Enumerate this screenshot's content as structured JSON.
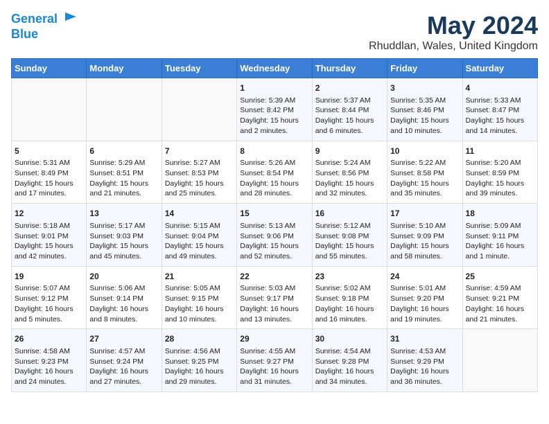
{
  "header": {
    "logo_line1": "General",
    "logo_line2": "Blue",
    "title": "May 2024",
    "subtitle": "Rhuddlan, Wales, United Kingdom"
  },
  "days_of_week": [
    "Sunday",
    "Monday",
    "Tuesday",
    "Wednesday",
    "Thursday",
    "Friday",
    "Saturday"
  ],
  "weeks": [
    [
      {
        "day": "",
        "empty": true
      },
      {
        "day": "",
        "empty": true
      },
      {
        "day": "",
        "empty": true
      },
      {
        "day": "1",
        "sunrise": "5:39 AM",
        "sunset": "8:42 PM",
        "daylight": "15 hours and 2 minutes."
      },
      {
        "day": "2",
        "sunrise": "5:37 AM",
        "sunset": "8:44 PM",
        "daylight": "15 hours and 6 minutes."
      },
      {
        "day": "3",
        "sunrise": "5:35 AM",
        "sunset": "8:46 PM",
        "daylight": "15 hours and 10 minutes."
      },
      {
        "day": "4",
        "sunrise": "5:33 AM",
        "sunset": "8:47 PM",
        "daylight": "15 hours and 14 minutes."
      }
    ],
    [
      {
        "day": "5",
        "sunrise": "5:31 AM",
        "sunset": "8:49 PM",
        "daylight": "15 hours and 17 minutes."
      },
      {
        "day": "6",
        "sunrise": "5:29 AM",
        "sunset": "8:51 PM",
        "daylight": "15 hours and 21 minutes."
      },
      {
        "day": "7",
        "sunrise": "5:27 AM",
        "sunset": "8:53 PM",
        "daylight": "15 hours and 25 minutes."
      },
      {
        "day": "8",
        "sunrise": "5:26 AM",
        "sunset": "8:54 PM",
        "daylight": "15 hours and 28 minutes."
      },
      {
        "day": "9",
        "sunrise": "5:24 AM",
        "sunset": "8:56 PM",
        "daylight": "15 hours and 32 minutes."
      },
      {
        "day": "10",
        "sunrise": "5:22 AM",
        "sunset": "8:58 PM",
        "daylight": "15 hours and 35 minutes."
      },
      {
        "day": "11",
        "sunrise": "5:20 AM",
        "sunset": "8:59 PM",
        "daylight": "15 hours and 39 minutes."
      }
    ],
    [
      {
        "day": "12",
        "sunrise": "5:18 AM",
        "sunset": "9:01 PM",
        "daylight": "15 hours and 42 minutes."
      },
      {
        "day": "13",
        "sunrise": "5:17 AM",
        "sunset": "9:03 PM",
        "daylight": "15 hours and 45 minutes."
      },
      {
        "day": "14",
        "sunrise": "5:15 AM",
        "sunset": "9:04 PM",
        "daylight": "15 hours and 49 minutes."
      },
      {
        "day": "15",
        "sunrise": "5:13 AM",
        "sunset": "9:06 PM",
        "daylight": "15 hours and 52 minutes."
      },
      {
        "day": "16",
        "sunrise": "5:12 AM",
        "sunset": "9:08 PM",
        "daylight": "15 hours and 55 minutes."
      },
      {
        "day": "17",
        "sunrise": "5:10 AM",
        "sunset": "9:09 PM",
        "daylight": "15 hours and 58 minutes."
      },
      {
        "day": "18",
        "sunrise": "5:09 AM",
        "sunset": "9:11 PM",
        "daylight": "16 hours and 1 minute."
      }
    ],
    [
      {
        "day": "19",
        "sunrise": "5:07 AM",
        "sunset": "9:12 PM",
        "daylight": "16 hours and 5 minutes."
      },
      {
        "day": "20",
        "sunrise": "5:06 AM",
        "sunset": "9:14 PM",
        "daylight": "16 hours and 8 minutes."
      },
      {
        "day": "21",
        "sunrise": "5:05 AM",
        "sunset": "9:15 PM",
        "daylight": "16 hours and 10 minutes."
      },
      {
        "day": "22",
        "sunrise": "5:03 AM",
        "sunset": "9:17 PM",
        "daylight": "16 hours and 13 minutes."
      },
      {
        "day": "23",
        "sunrise": "5:02 AM",
        "sunset": "9:18 PM",
        "daylight": "16 hours and 16 minutes."
      },
      {
        "day": "24",
        "sunrise": "5:01 AM",
        "sunset": "9:20 PM",
        "daylight": "16 hours and 19 minutes."
      },
      {
        "day": "25",
        "sunrise": "4:59 AM",
        "sunset": "9:21 PM",
        "daylight": "16 hours and 21 minutes."
      }
    ],
    [
      {
        "day": "26",
        "sunrise": "4:58 AM",
        "sunset": "9:23 PM",
        "daylight": "16 hours and 24 minutes."
      },
      {
        "day": "27",
        "sunrise": "4:57 AM",
        "sunset": "9:24 PM",
        "daylight": "16 hours and 27 minutes."
      },
      {
        "day": "28",
        "sunrise": "4:56 AM",
        "sunset": "9:25 PM",
        "daylight": "16 hours and 29 minutes."
      },
      {
        "day": "29",
        "sunrise": "4:55 AM",
        "sunset": "9:27 PM",
        "daylight": "16 hours and 31 minutes."
      },
      {
        "day": "30",
        "sunrise": "4:54 AM",
        "sunset": "9:28 PM",
        "daylight": "16 hours and 34 minutes."
      },
      {
        "day": "31",
        "sunrise": "4:53 AM",
        "sunset": "9:29 PM",
        "daylight": "16 hours and 36 minutes."
      },
      {
        "day": "",
        "empty": true
      }
    ]
  ],
  "labels": {
    "sunrise": "Sunrise:",
    "sunset": "Sunset:",
    "daylight": "Daylight:"
  }
}
